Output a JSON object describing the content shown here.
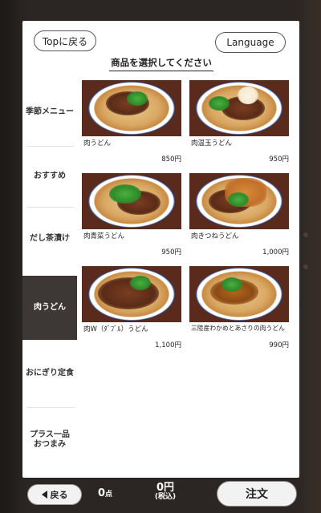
{
  "header": {
    "top_label": "Topに戻る",
    "language_label": "Language",
    "title": "商品を選択してください"
  },
  "sidebar": {
    "items": [
      {
        "label": "季節メニュー",
        "active": false
      },
      {
        "label": "おすすめ",
        "active": false
      },
      {
        "label": "だし茶漬け",
        "active": false
      },
      {
        "label": "肉うどん",
        "active": true
      },
      {
        "label": "おにぎり定食",
        "active": false
      },
      {
        "label": "プラス一品\nおつまみ",
        "active": false
      }
    ]
  },
  "menu": {
    "items": [
      {
        "name": "肉うどん",
        "price": "850円",
        "topping": "beef-green"
      },
      {
        "name": "肉温玉うどん",
        "price": "950円",
        "topping": "beef-egg"
      },
      {
        "name": "肉青菜うどん",
        "price": "950円",
        "topping": "beef-greens"
      },
      {
        "name": "肉きつねうどん",
        "price": "1,000円",
        "topping": "beef-fried-tofu"
      },
      {
        "name": "肉W（ﾀﾞﾌﾞﾙ）うどん",
        "price": "1,100円",
        "topping": "double-beef"
      },
      {
        "name": "三陸産わかめとあさりの肉うどん",
        "price": "990円",
        "topping": "seafood"
      }
    ]
  },
  "footer": {
    "back_label": "戻る",
    "count_value": "0",
    "count_unit": "点",
    "total_amount": "0円",
    "total_tax": "(税込)",
    "order_label": "注文"
  },
  "colors": {
    "active_sidebar": "#3d3835",
    "bezel": "#2a2522",
    "bowl_rim": "#1d3a80"
  }
}
